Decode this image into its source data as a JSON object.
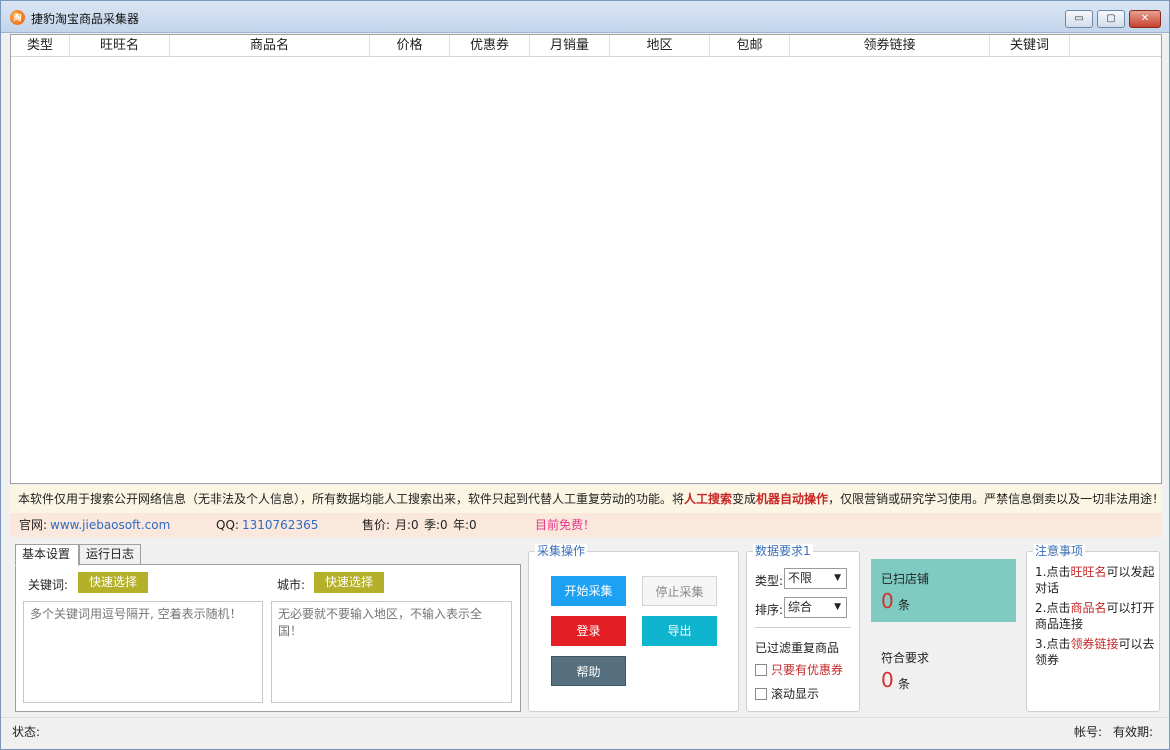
{
  "window": {
    "title": "捷豹淘宝商品采集器",
    "icon_text": "淘"
  },
  "window_controls": {
    "minimize": "▭",
    "maximize": "▢",
    "close": "✕"
  },
  "grid": {
    "columns": [
      "类型",
      "旺旺名",
      "商品名",
      "价格",
      "优惠券",
      "月销量",
      "地区",
      "包邮",
      "领券链接",
      "关键词"
    ],
    "rows": []
  },
  "notice": {
    "part1": "本软件仅用于搜索公开网络信息（无非法及个人信息），所有数据均能人工搜索出来，软件只起到代替人工重复劳动的功能。将",
    "highlight1": "人工搜索",
    "part2": "变成",
    "highlight2": "机器自动操作",
    "part3": "，仅限营销或研究学习使用。严禁信息倒卖以及一切非法用途！"
  },
  "info": {
    "site_label": "官网:",
    "site_url": "www.jiebaosoft.com",
    "qq_label": "QQ:",
    "qq_value": "1310762365",
    "price_label": "售价:",
    "price_month": "月:0",
    "price_quarter": "季:0",
    "price_year": "年:0",
    "free_text": "目前免费！"
  },
  "tabs": {
    "basic": "基本设置",
    "log": "运行日志"
  },
  "basic": {
    "keyword_label": "关键词:",
    "keyword_quick": "快速选择",
    "keyword_placeholder": "多个关键词用逗号隔开, 空着表示随机！",
    "city_label": "城市:",
    "city_quick": "快速选择",
    "city_placeholder": "无必要就不要输入地区，不输入表示全国！"
  },
  "ops": {
    "title": "采集操作",
    "start": "开始采集",
    "stop": "停止采集",
    "login": "登录",
    "export": "导出",
    "help": "帮助"
  },
  "requirements": {
    "title": "数据要求1",
    "type_label": "类型:",
    "type_value": "不限",
    "sort_label": "排序:",
    "sort_value": "综合",
    "dedup_text": "已过滤重复商品",
    "coupon_only": "只要有优惠券",
    "scroll_display": "滚动显示"
  },
  "stats": {
    "scanned_label": "已扫店铺",
    "scanned_value": "0",
    "scanned_unit": "条",
    "matched_label": "符合要求",
    "matched_value": "0",
    "matched_unit": "条"
  },
  "notes": {
    "title": "注意事项",
    "n1_pre": "1.点击",
    "n1_hl": "旺旺名",
    "n1_post": "可以发起对话",
    "n2_pre": "2.点击",
    "n2_hl": "商品名",
    "n2_post": "可以打开商品连接",
    "n3_pre": "3.点击",
    "n3_hl": "领券链接",
    "n3_post": "可以去领券"
  },
  "status": {
    "state_label": "状态:",
    "account_label": "帐号:",
    "expiry_label": "有效期:"
  },
  "colors": {
    "start": "#1da1f2",
    "login": "#e31e24",
    "export": "#0fb5cf",
    "help": "#56707f",
    "quick_select": "#b5b029",
    "scanned_card": "#7fcbc2",
    "highlight": "#c62828"
  }
}
